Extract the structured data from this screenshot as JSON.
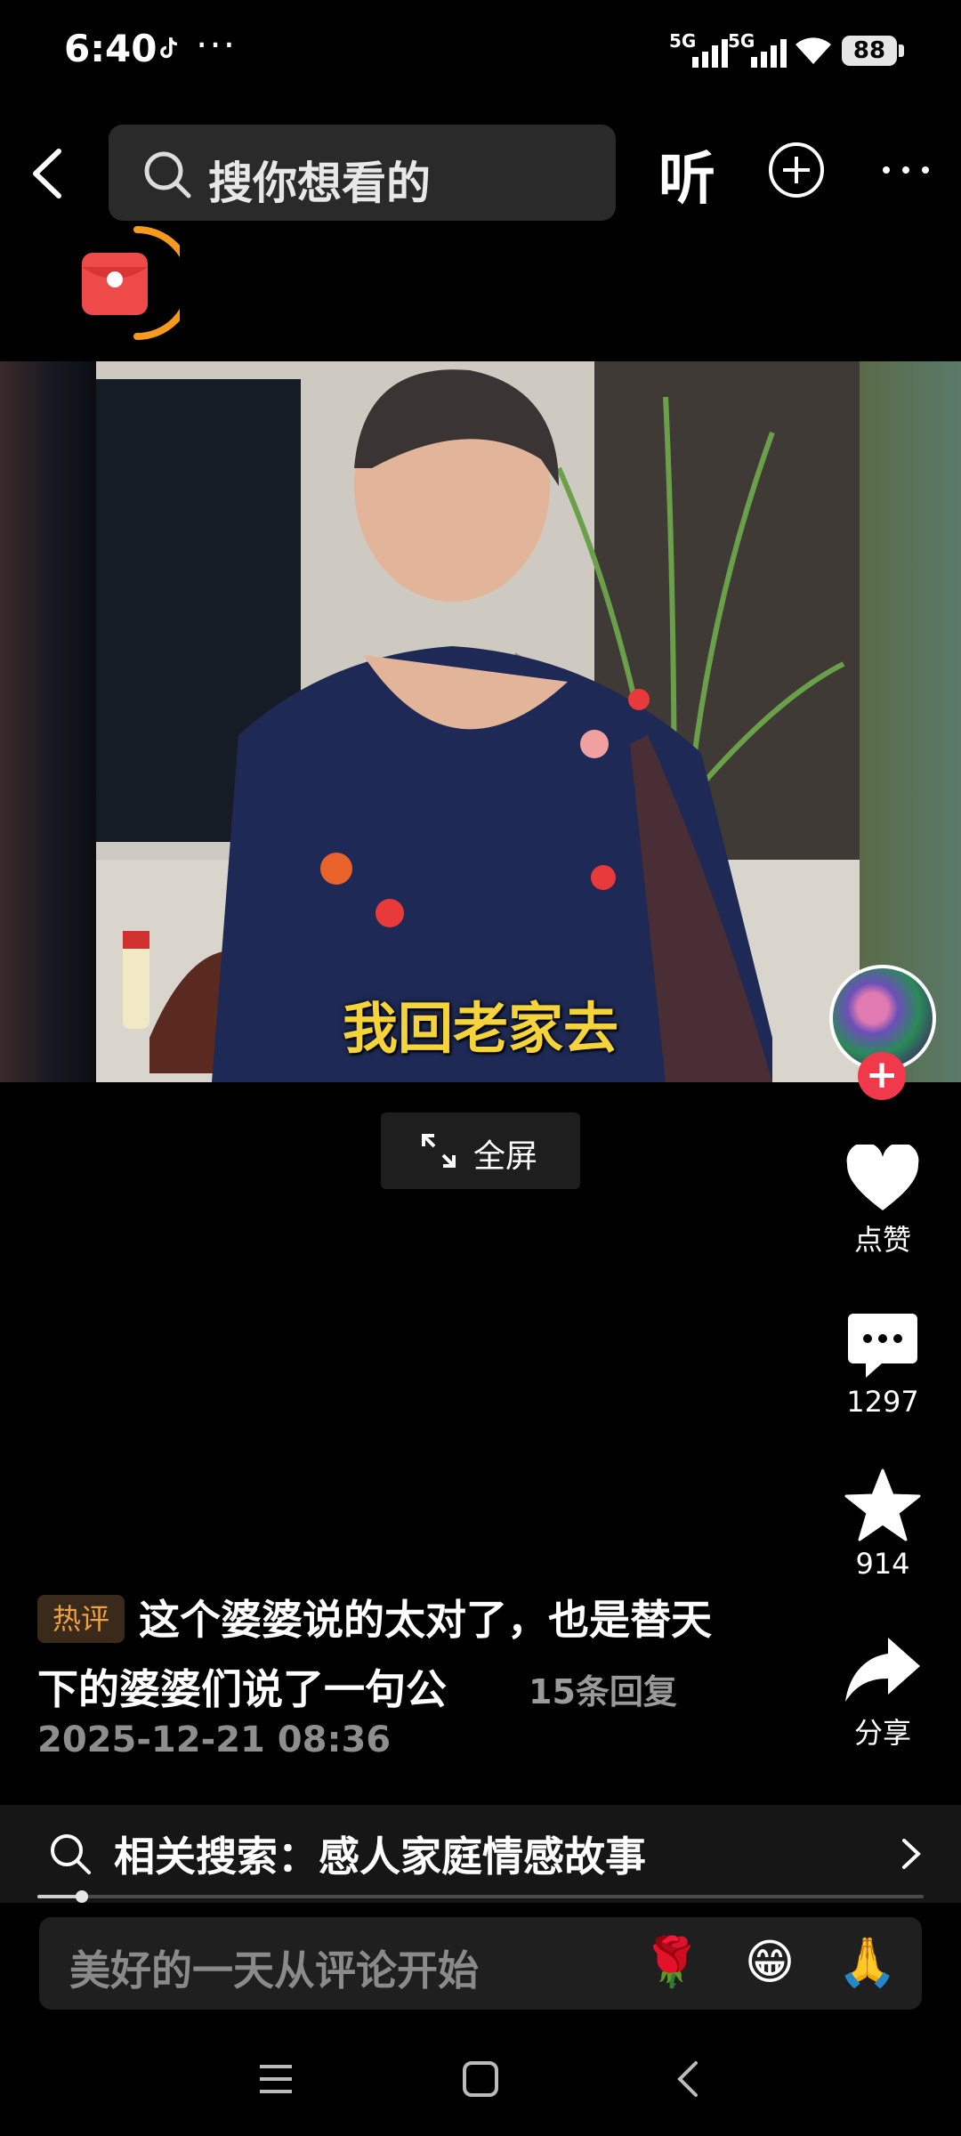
{
  "status": {
    "time": "6:40",
    "dots": "···",
    "sig1": "5G",
    "sig2": "5G",
    "battery": "88"
  },
  "topbar": {
    "search_placeholder": "搜你想看的",
    "listen": "听"
  },
  "video": {
    "subtitle": "我回老家去",
    "fullscreen": "全屏"
  },
  "actions": {
    "like_label": "点赞",
    "comment_count": "1297",
    "favorite_count": "914",
    "share_label": "分享"
  },
  "hot_comment": {
    "tag": "热评",
    "line1": "这个婆婆说的太对了，也是替天",
    "line2": "下的婆婆们说了一句公",
    "replies": "15条回复",
    "timestamp": "2025-12-21 08:36"
  },
  "related": {
    "text": "相关搜索：感人家庭情感故事"
  },
  "playback": {
    "progress_fraction": 0.05
  },
  "comment_input": {
    "placeholder": "美好的一天从评论开始"
  },
  "emojis": [
    "🌹",
    "😁",
    "🙏"
  ],
  "colors": {
    "accent_red": "#f03a4c",
    "subtitle_yellow": "#f4d43a",
    "hot_orange": "#f0a040"
  }
}
